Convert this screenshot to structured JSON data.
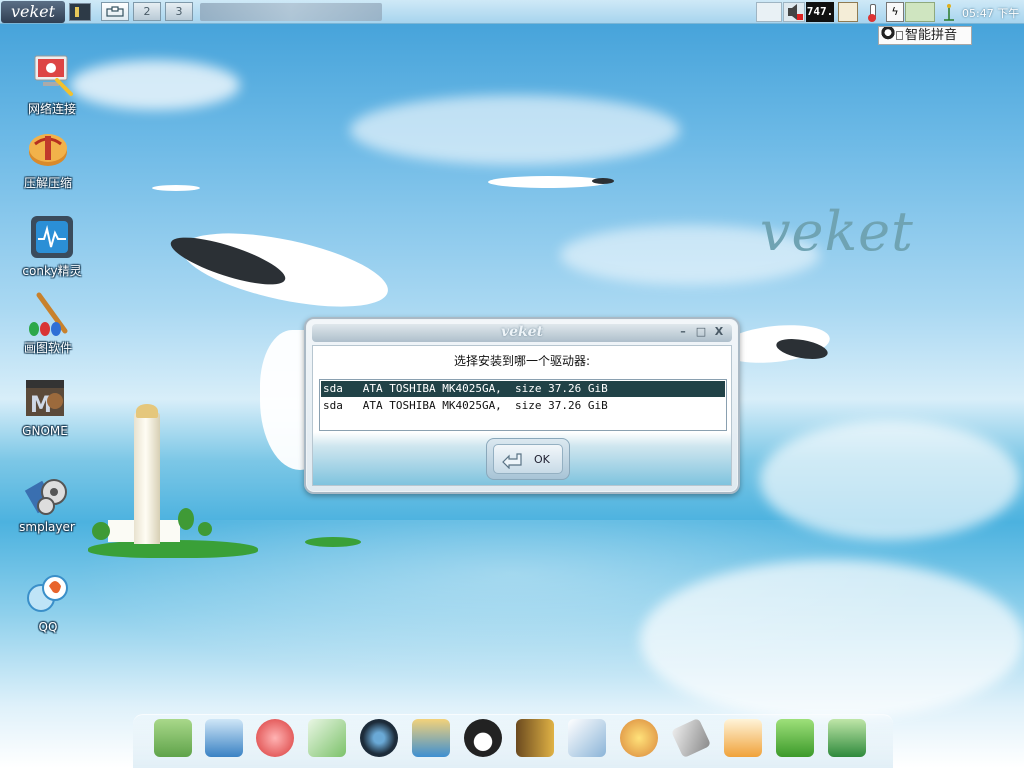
{
  "top_panel": {
    "logo": "veket",
    "workspaces": [
      "1",
      "2",
      "3"
    ],
    "active_workspace_icon": "desktop-switch-icon",
    "cpu_readout": "747.",
    "clock": "05:47 下午"
  },
  "ime": {
    "label": "智能拼音"
  },
  "desktop_icons": [
    {
      "label": "网络连接",
      "icon": "network-icon"
    },
    {
      "label": "压解压缩",
      "icon": "archive-icon"
    },
    {
      "label": "conky精灵",
      "icon": "monitor-icon"
    },
    {
      "label": "画图软件",
      "icon": "paint-icon"
    },
    {
      "label": "GNOME",
      "icon": "gnome-icon"
    },
    {
      "label": "smplayer",
      "icon": "media-player-icon"
    },
    {
      "label": "QQ",
      "icon": "qq-icon"
    }
  ],
  "wallpaper": {
    "brand": "veket"
  },
  "dialog": {
    "title": "veket",
    "minimize": "–",
    "maximize": "□",
    "close": "X",
    "prompt": "选择安装到哪一个驱动器:",
    "drives": [
      "sda   ATA TOSHIBA MK4025GA,  size 37.26 GiB",
      "sda   ATA TOSHIBA MK4025GA,  size 37.26 GiB"
    ],
    "selected_index": 0,
    "ok_label": "OK"
  },
  "dock": {
    "items": [
      "folder-icon",
      "computer-icon",
      "game-icon",
      "text-editor-icon",
      "audio-player-icon",
      "messenger-icon",
      "penguin-icon",
      "notebook-icon",
      "chart-app-icon",
      "paint-palette-icon",
      "usb-drive-icon",
      "image-viewer-icon",
      "help-icon",
      "camera-icon"
    ]
  }
}
